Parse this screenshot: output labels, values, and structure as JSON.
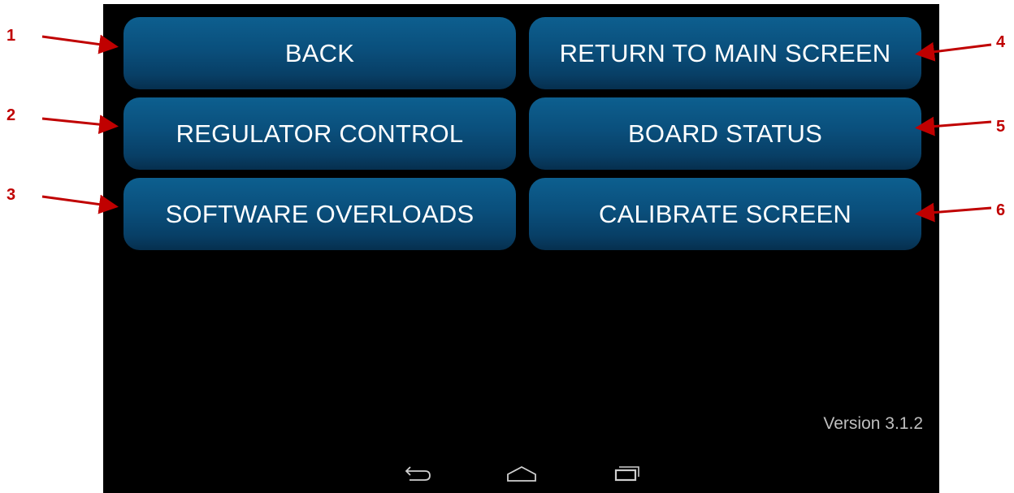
{
  "buttons": {
    "back": "BACK",
    "regulator_control": "REGULATOR CONTROL",
    "software_overloads": "SOFTWARE OVERLOADS",
    "return_main": "RETURN TO MAIN SCREEN",
    "board_status": "BOARD STATUS",
    "calibrate_screen": "CALIBRATE SCREEN"
  },
  "version": "Version 3.1.2",
  "annotations": [
    "1",
    "2",
    "3",
    "4",
    "5",
    "6"
  ],
  "colors": {
    "annotation": "#c00000",
    "button_top": "#0d5f8f",
    "button_bottom": "#062f4e",
    "screen_bg": "#000000",
    "version_text": "#bfbfbf"
  },
  "nav_icons": [
    "back-icon",
    "home-icon",
    "recent-apps-icon"
  ]
}
